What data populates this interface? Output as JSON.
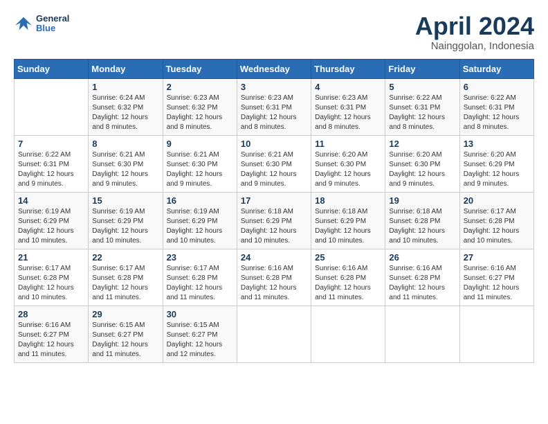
{
  "header": {
    "logo": {
      "general": "General",
      "blue": "Blue"
    },
    "month_year": "April 2024",
    "location": "Nainggolan, Indonesia"
  },
  "weekdays": [
    "Sunday",
    "Monday",
    "Tuesday",
    "Wednesday",
    "Thursday",
    "Friday",
    "Saturday"
  ],
  "weeks": [
    [
      {
        "day": "",
        "info": ""
      },
      {
        "day": "1",
        "info": "Sunrise: 6:24 AM\nSunset: 6:32 PM\nDaylight: 12 hours\nand 8 minutes."
      },
      {
        "day": "2",
        "info": "Sunrise: 6:23 AM\nSunset: 6:32 PM\nDaylight: 12 hours\nand 8 minutes."
      },
      {
        "day": "3",
        "info": "Sunrise: 6:23 AM\nSunset: 6:31 PM\nDaylight: 12 hours\nand 8 minutes."
      },
      {
        "day": "4",
        "info": "Sunrise: 6:23 AM\nSunset: 6:31 PM\nDaylight: 12 hours\nand 8 minutes."
      },
      {
        "day": "5",
        "info": "Sunrise: 6:22 AM\nSunset: 6:31 PM\nDaylight: 12 hours\nand 8 minutes."
      },
      {
        "day": "6",
        "info": "Sunrise: 6:22 AM\nSunset: 6:31 PM\nDaylight: 12 hours\nand 8 minutes."
      }
    ],
    [
      {
        "day": "7",
        "info": "Sunrise: 6:22 AM\nSunset: 6:31 PM\nDaylight: 12 hours\nand 9 minutes."
      },
      {
        "day": "8",
        "info": "Sunrise: 6:21 AM\nSunset: 6:30 PM\nDaylight: 12 hours\nand 9 minutes."
      },
      {
        "day": "9",
        "info": "Sunrise: 6:21 AM\nSunset: 6:30 PM\nDaylight: 12 hours\nand 9 minutes."
      },
      {
        "day": "10",
        "info": "Sunrise: 6:21 AM\nSunset: 6:30 PM\nDaylight: 12 hours\nand 9 minutes."
      },
      {
        "day": "11",
        "info": "Sunrise: 6:20 AM\nSunset: 6:30 PM\nDaylight: 12 hours\nand 9 minutes."
      },
      {
        "day": "12",
        "info": "Sunrise: 6:20 AM\nSunset: 6:30 PM\nDaylight: 12 hours\nand 9 minutes."
      },
      {
        "day": "13",
        "info": "Sunrise: 6:20 AM\nSunset: 6:29 PM\nDaylight: 12 hours\nand 9 minutes."
      }
    ],
    [
      {
        "day": "14",
        "info": "Sunrise: 6:19 AM\nSunset: 6:29 PM\nDaylight: 12 hours\nand 10 minutes."
      },
      {
        "day": "15",
        "info": "Sunrise: 6:19 AM\nSunset: 6:29 PM\nDaylight: 12 hours\nand 10 minutes."
      },
      {
        "day": "16",
        "info": "Sunrise: 6:19 AM\nSunset: 6:29 PM\nDaylight: 12 hours\nand 10 minutes."
      },
      {
        "day": "17",
        "info": "Sunrise: 6:18 AM\nSunset: 6:29 PM\nDaylight: 12 hours\nand 10 minutes."
      },
      {
        "day": "18",
        "info": "Sunrise: 6:18 AM\nSunset: 6:29 PM\nDaylight: 12 hours\nand 10 minutes."
      },
      {
        "day": "19",
        "info": "Sunrise: 6:18 AM\nSunset: 6:28 PM\nDaylight: 12 hours\nand 10 minutes."
      },
      {
        "day": "20",
        "info": "Sunrise: 6:17 AM\nSunset: 6:28 PM\nDaylight: 12 hours\nand 10 minutes."
      }
    ],
    [
      {
        "day": "21",
        "info": "Sunrise: 6:17 AM\nSunset: 6:28 PM\nDaylight: 12 hours\nand 10 minutes."
      },
      {
        "day": "22",
        "info": "Sunrise: 6:17 AM\nSunset: 6:28 PM\nDaylight: 12 hours\nand 11 minutes."
      },
      {
        "day": "23",
        "info": "Sunrise: 6:17 AM\nSunset: 6:28 PM\nDaylight: 12 hours\nand 11 minutes."
      },
      {
        "day": "24",
        "info": "Sunrise: 6:16 AM\nSunset: 6:28 PM\nDaylight: 12 hours\nand 11 minutes."
      },
      {
        "day": "25",
        "info": "Sunrise: 6:16 AM\nSunset: 6:28 PM\nDaylight: 12 hours\nand 11 minutes."
      },
      {
        "day": "26",
        "info": "Sunrise: 6:16 AM\nSunset: 6:28 PM\nDaylight: 12 hours\nand 11 minutes."
      },
      {
        "day": "27",
        "info": "Sunrise: 6:16 AM\nSunset: 6:27 PM\nDaylight: 12 hours\nand 11 minutes."
      }
    ],
    [
      {
        "day": "28",
        "info": "Sunrise: 6:16 AM\nSunset: 6:27 PM\nDaylight: 12 hours\nand 11 minutes."
      },
      {
        "day": "29",
        "info": "Sunrise: 6:15 AM\nSunset: 6:27 PM\nDaylight: 12 hours\nand 11 minutes."
      },
      {
        "day": "30",
        "info": "Sunrise: 6:15 AM\nSunset: 6:27 PM\nDaylight: 12 hours\nand 12 minutes."
      },
      {
        "day": "",
        "info": ""
      },
      {
        "day": "",
        "info": ""
      },
      {
        "day": "",
        "info": ""
      },
      {
        "day": "",
        "info": ""
      }
    ]
  ]
}
